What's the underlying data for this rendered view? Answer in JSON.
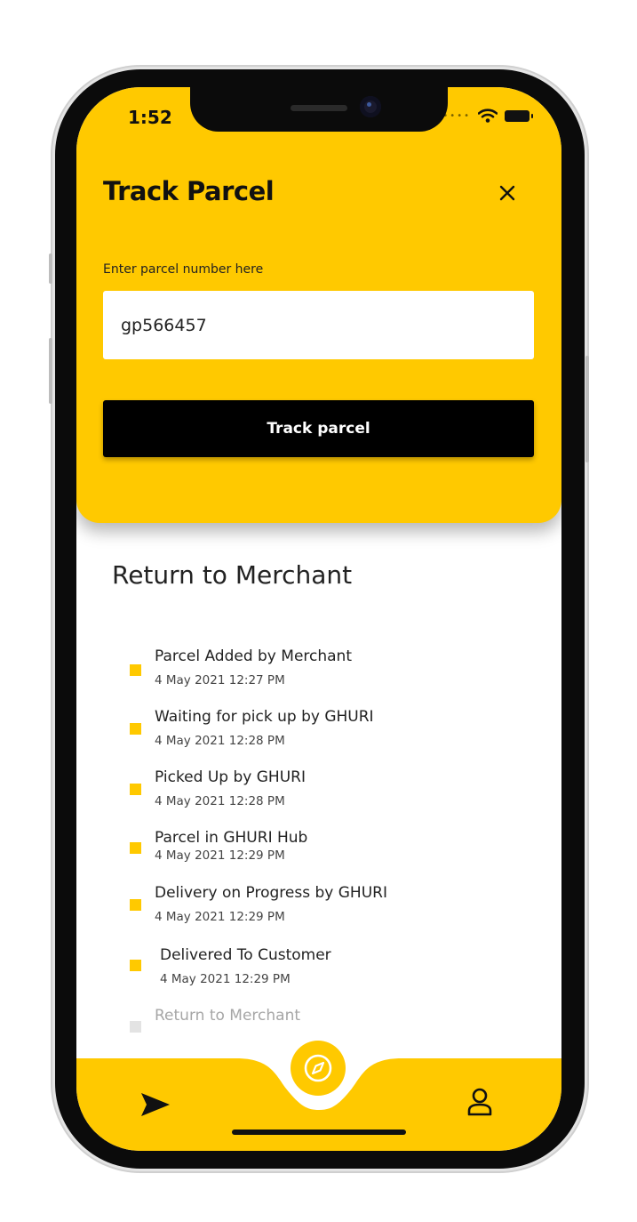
{
  "status_bar": {
    "time": "1:52"
  },
  "header": {
    "title": "Track Parcel",
    "close_icon": "close-icon",
    "input_label": "Enter parcel number here",
    "input_value": "gp566457",
    "track_button_label": "Track parcel"
  },
  "tracking": {
    "current_status": "Return to Merchant",
    "steps": [
      {
        "label": "Parcel Added by Merchant",
        "time": "4 May 2021 12:27 PM",
        "done": true
      },
      {
        "label": "Waiting for pick up by GHURI",
        "time": "4 May 2021 12:28 PM",
        "done": true
      },
      {
        "label": "Picked Up by GHURI",
        "time": "4 May 2021 12:28 PM",
        "done": true
      },
      {
        "label": "Parcel in GHURI Hub",
        "time": "4 May 2021 12:29 PM",
        "done": true
      },
      {
        "label": "Delivery on Progress by GHURI",
        "time": "4 May 2021 12:29 PM",
        "done": true
      },
      {
        "label": "Delivered To Customer",
        "time": "4 May 2021 12:29 PM",
        "done": true
      },
      {
        "label": "Return to Merchant",
        "time": "",
        "done": false
      }
    ]
  },
  "bottom_nav": {
    "left_icon": "send-icon",
    "center_icon": "compass-icon",
    "right_icon": "profile-icon"
  },
  "colors": {
    "accent": "#ffc900",
    "button": "#000000",
    "pending": "#e3e3e3"
  }
}
